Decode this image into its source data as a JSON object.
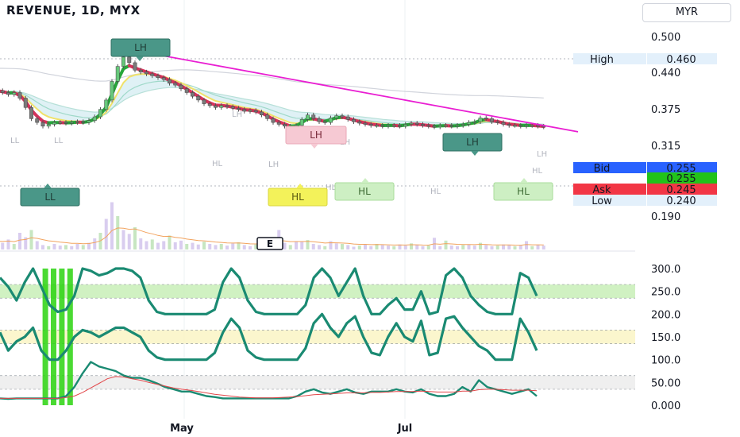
{
  "header": {
    "title": "REVENUE, 1D, MYX",
    "currency_button": "MYR"
  },
  "chart_data": [
    {
      "type": "candlestick",
      "title": "REVENUE, 1D, MYX",
      "ylim": [
        0.17,
        0.53
      ],
      "y_ticks": [
        "0.500",
        "0.440",
        "0.375",
        "0.315",
        "0.190"
      ],
      "x_ticks": [
        "May",
        "Jul"
      ],
      "price_labels": [
        {
          "name": "High",
          "value": "0.460",
          "color": "#e3f0fb"
        },
        {
          "name": "Bid",
          "value": "0.255",
          "color": "#2962ff"
        },
        {
          "name": "",
          "value": "0.255",
          "color": "#22c31a"
        },
        {
          "name": "Ask",
          "value": "0.245",
          "color": "#f23645"
        },
        {
          "name": "Low",
          "value": "0.240",
          "color": "#e3f0fb"
        }
      ],
      "pivot_tags": [
        {
          "label": "LH",
          "style": "teal"
        },
        {
          "label": "LL",
          "style": "teal"
        },
        {
          "label": "LH",
          "style": "pink"
        },
        {
          "label": "HL",
          "style": "yellow"
        },
        {
          "label": "HL",
          "style": "lightgreen"
        },
        {
          "label": "LH",
          "style": "teal"
        },
        {
          "label": "HL",
          "style": "lightgreen"
        }
      ],
      "pivot_marks": [
        "LL",
        "LL",
        "LH",
        "HL",
        "LH",
        "LH",
        "HL",
        "LH",
        "HL",
        "LH",
        "HL"
      ],
      "event_marker": "E",
      "trendline": {
        "from_value": 0.46,
        "to_value": 0.245,
        "color": "#e91ed2"
      },
      "close": [
        0.355,
        0.35,
        0.345,
        0.35,
        0.335,
        0.31,
        0.28,
        0.27,
        0.26,
        0.265,
        0.27,
        0.27,
        0.268,
        0.27,
        0.272,
        0.27,
        0.275,
        0.285,
        0.305,
        0.33,
        0.38,
        0.42,
        0.445,
        0.43,
        0.41,
        0.405,
        0.4,
        0.395,
        0.39,
        0.385,
        0.375,
        0.37,
        0.36,
        0.35,
        0.34,
        0.33,
        0.32,
        0.315,
        0.31,
        0.315,
        0.312,
        0.308,
        0.305,
        0.3,
        0.302,
        0.298,
        0.29,
        0.28,
        0.27,
        0.265,
        0.26,
        0.255,
        0.262,
        0.278,
        0.29,
        0.28,
        0.272,
        0.27,
        0.282,
        0.288,
        0.285,
        0.278,
        0.272,
        0.268,
        0.265,
        0.262,
        0.262,
        0.26,
        0.262,
        0.262,
        0.26,
        0.265,
        0.268,
        0.265,
        0.262,
        0.26,
        0.258,
        0.262,
        0.262,
        0.26,
        0.262,
        0.265,
        0.27,
        0.272,
        0.282,
        0.28,
        0.272,
        0.27,
        0.265,
        0.262,
        0.262,
        0.26,
        0.262,
        0.262,
        0.26,
        0.258
      ],
      "volume": [
        1.5,
        1.2,
        1.8,
        1.0,
        3.0,
        2.2,
        3.5,
        1.5,
        0.8,
        0.6,
        1.0,
        0.7,
        0.8,
        0.6,
        1.0,
        0.8,
        1.2,
        2.0,
        3.0,
        5.5,
        8.5,
        6.0,
        3.5,
        2.8,
        4.0,
        2.0,
        1.5,
        1.8,
        1.2,
        1.5,
        2.5,
        1.3,
        1.6,
        1.0,
        1.2,
        0.9,
        1.4,
        1.0,
        0.8,
        1.0,
        0.7,
        1.1,
        1.3,
        0.8,
        0.6,
        0.9,
        1.2,
        1.0,
        2.0,
        3.5,
        1.2,
        0.8,
        1.5,
        1.4,
        1.7,
        1.0,
        0.8,
        0.6,
        1.5,
        1.1,
        1.0,
        0.8,
        0.5,
        0.7,
        0.9,
        0.6,
        1.0,
        0.8,
        0.7,
        0.6,
        0.9,
        0.7,
        1.1,
        0.8,
        0.6,
        0.7,
        2.1,
        0.6,
        1.6,
        0.7,
        0.6,
        0.8,
        0.9,
        0.7,
        1.2,
        0.8,
        0.6,
        0.7,
        0.9,
        0.8,
        0.6,
        0.7,
        1.5,
        0.6,
        0.8,
        0.7
      ]
    },
    {
      "type": "line",
      "title": "",
      "ylim": [
        0,
        300
      ],
      "y_ticks": [
        "300.0",
        "250.0",
        "200.0",
        "150.0",
        "100.0",
        "50.00",
        "0.000"
      ],
      "bands": [
        {
          "from": 235,
          "to": 265,
          "color": "#c8efb7"
        },
        {
          "from": 135,
          "to": 165,
          "color": "#faf4c4"
        },
        {
          "from": 35,
          "to": 65,
          "color": "#ececec"
        }
      ],
      "highlight_columns": [
        4,
        5,
        6,
        7
      ],
      "series": [
        {
          "values": [
            280,
            260,
            230,
            270,
            300,
            260,
            220,
            205,
            210,
            240,
            300,
            295,
            285,
            290,
            300,
            300,
            295,
            280,
            230,
            205,
            200,
            200,
            200,
            200,
            200,
            200,
            210,
            270,
            300,
            280,
            230,
            205,
            200,
            200,
            200,
            200,
            200,
            220,
            280,
            300,
            280,
            240,
            270,
            300,
            240,
            200,
            200,
            220,
            235,
            210,
            210,
            250,
            200,
            205,
            285,
            300,
            280,
            240,
            220,
            205,
            200,
            200,
            200,
            290,
            280,
            240
          ]
        },
        {
          "values": [
            160,
            120,
            140,
            150,
            170,
            120,
            100,
            100,
            120,
            150,
            165,
            160,
            150,
            160,
            170,
            170,
            160,
            150,
            120,
            105,
            100,
            100,
            100,
            100,
            100,
            100,
            115,
            160,
            190,
            170,
            120,
            105,
            100,
            100,
            100,
            100,
            100,
            125,
            180,
            200,
            170,
            150,
            180,
            195,
            150,
            115,
            110,
            150,
            180,
            150,
            140,
            185,
            110,
            115,
            190,
            195,
            170,
            150,
            130,
            120,
            100,
            100,
            100,
            190,
            160,
            120
          ]
        },
        {
          "values": [
            15,
            14,
            15,
            15,
            15,
            15,
            15,
            15,
            20,
            40,
            70,
            95,
            85,
            80,
            75,
            65,
            60,
            60,
            55,
            48,
            40,
            35,
            30,
            30,
            25,
            20,
            18,
            15,
            15,
            15,
            15,
            15,
            15,
            15,
            15,
            15,
            20,
            30,
            35,
            28,
            25,
            30,
            35,
            28,
            25,
            30,
            30,
            30,
            35,
            30,
            28,
            35,
            25,
            20,
            20,
            25,
            40,
            30,
            55,
            40,
            35,
            30,
            25,
            30,
            35,
            20
          ]
        },
        {
          "values": [
            15,
            15,
            15,
            15,
            15,
            15,
            15,
            15,
            17,
            20,
            28,
            38,
            48,
            58,
            63,
            62,
            58,
            55,
            50,
            46,
            42,
            38,
            35,
            33,
            30,
            27,
            24,
            22,
            20,
            18,
            17,
            16,
            16,
            16,
            17,
            18,
            19,
            21,
            23,
            24,
            25,
            26,
            27,
            27,
            27,
            28,
            28,
            29,
            30,
            30,
            30,
            31,
            30,
            29,
            29,
            29,
            31,
            31,
            34,
            35,
            35,
            34,
            33,
            33,
            33,
            32
          ]
        }
      ]
    }
  ]
}
